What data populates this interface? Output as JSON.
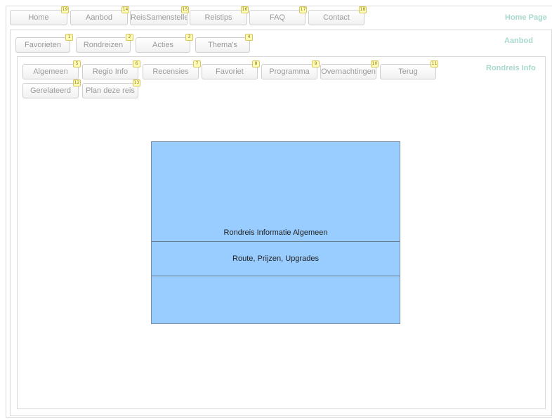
{
  "home_nav": {
    "title": "Home Page",
    "tabs": [
      {
        "label": "Home",
        "badge": "19"
      },
      {
        "label": "Aanbod",
        "badge": "14"
      },
      {
        "label": "ReisSamenstelle",
        "badge": "15"
      },
      {
        "label": "Reistips",
        "badge": "16"
      },
      {
        "label": "FAQ",
        "badge": "17"
      },
      {
        "label": "Contact",
        "badge": "18"
      }
    ]
  },
  "aanbod_nav": {
    "title": "Aanbod",
    "tabs": [
      {
        "label": "Favorieten",
        "badge": "1"
      },
      {
        "label": "Rondreizen",
        "badge": "2"
      },
      {
        "label": "Acties",
        "badge": "3"
      },
      {
        "label": "Thema's",
        "badge": "4"
      }
    ]
  },
  "rondreis_nav": {
    "title": "Rondreis Info",
    "tabs": [
      {
        "label": "Algemeen",
        "badge": "5"
      },
      {
        "label": "Regio Info",
        "badge": "6"
      },
      {
        "label": "Recensies",
        "badge": "7"
      },
      {
        "label": "Favoriet",
        "badge": "8"
      },
      {
        "label": "Programma",
        "badge": "9"
      },
      {
        "label": "Overnachtingen",
        "badge": "10"
      },
      {
        "label": "Terug",
        "badge": "11"
      },
      {
        "label": "Gerelateerd",
        "badge": "12"
      },
      {
        "label": "Plan deze reis",
        "badge": "13"
      }
    ]
  },
  "info_box": {
    "line1": "Rondreis Informatie Algemeen",
    "line2": "Route, Prijzen, Upgrades"
  }
}
